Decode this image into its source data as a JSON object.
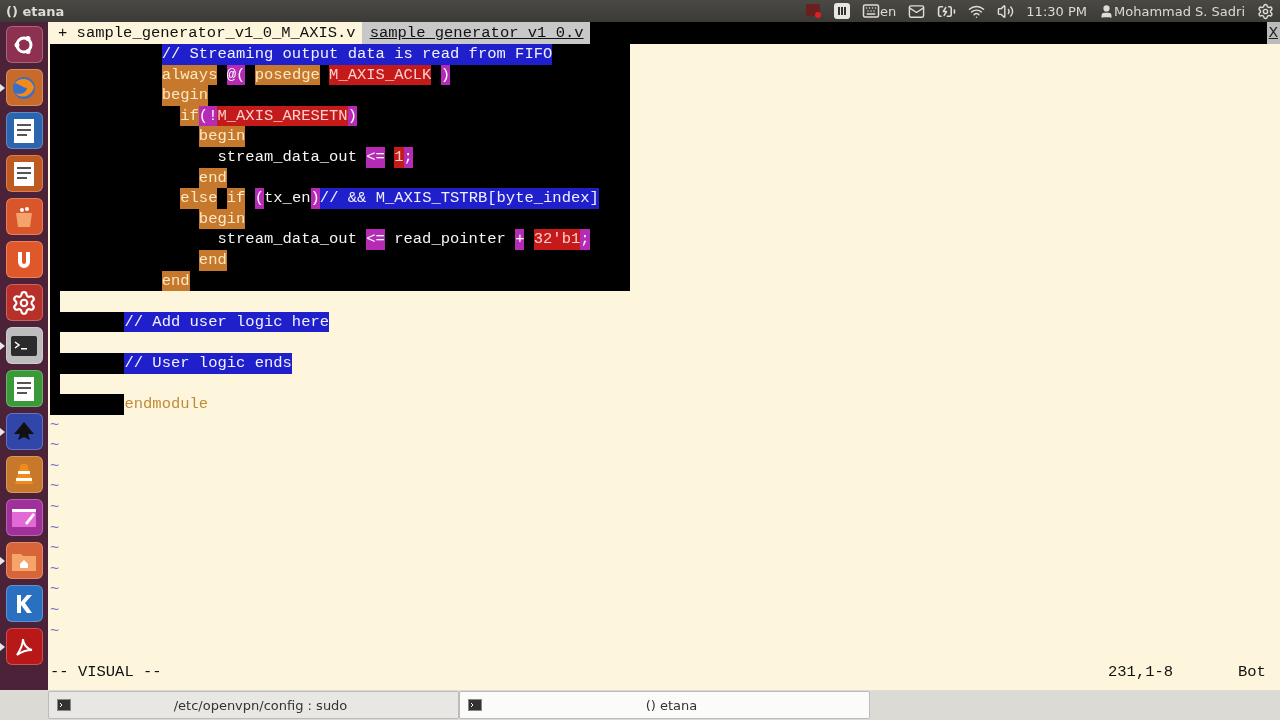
{
  "top_panel": {
    "title": "() etana",
    "keyboard_layout": "en",
    "clock": "11:30 PM",
    "user": "Mohammad S. Sadri"
  },
  "launcher": [
    {
      "kind": "ubuntu",
      "running": false
    },
    {
      "kind": "firefox",
      "running": true
    },
    {
      "kind": "writer",
      "running": false
    },
    {
      "kind": "impress",
      "running": false
    },
    {
      "kind": "software",
      "running": false
    },
    {
      "kind": "ubuntuone",
      "running": false
    },
    {
      "kind": "settings",
      "running": false
    },
    {
      "kind": "terminal",
      "running": true
    },
    {
      "kind": "calc",
      "running": false
    },
    {
      "kind": "inkscape",
      "running": true
    },
    {
      "kind": "vlc",
      "running": false
    },
    {
      "kind": "video",
      "running": false
    },
    {
      "kind": "files",
      "running": true
    },
    {
      "kind": "kde",
      "running": false
    },
    {
      "kind": "acrobat",
      "running": true
    }
  ],
  "editor": {
    "tabs": [
      {
        "label": "+ sample_generator_v1_0_M_AXIS.v",
        "selected": true
      },
      {
        "label": "sample_generator_v1_0.v",
        "selected": false
      }
    ],
    "close_label": "X",
    "lines": [
      {
        "kind": "block",
        "segments": [
          {
            "kind": "comment",
            "text": "            // Streaming output data is read from FIFO"
          }
        ]
      },
      {
        "kind": "block",
        "segments": [
          {
            "kind": "keyword",
            "text": "            always "
          },
          {
            "kind": "operator",
            "text": "@( "
          },
          {
            "kind": "keyword",
            "text": "posedge "
          },
          {
            "kind": "constant",
            "text": "M_AXIS_ACLK "
          },
          {
            "kind": "operator",
            "text": ")"
          }
        ]
      },
      {
        "kind": "block",
        "segments": [
          {
            "kind": "keyword",
            "text": "            begin"
          }
        ]
      },
      {
        "kind": "block",
        "segments": [
          {
            "kind": "keyword",
            "text": "              if"
          },
          {
            "kind": "operator",
            "text": "(!"
          },
          {
            "kind": "constant",
            "text": "M_AXIS_ARESETN"
          },
          {
            "kind": "operator",
            "text": ")"
          }
        ]
      },
      {
        "kind": "block",
        "segments": [
          {
            "kind": "keyword",
            "text": "                begin"
          }
        ]
      },
      {
        "kind": "block",
        "segments": [
          {
            "kind": "text",
            "text": "                  stream_data_out "
          },
          {
            "kind": "operator",
            "text": "<= "
          },
          {
            "kind": "constant",
            "text": "1"
          },
          {
            "kind": "operator",
            "text": ";"
          }
        ]
      },
      {
        "kind": "block",
        "segments": [
          {
            "kind": "keyword",
            "text": "                end"
          }
        ]
      },
      {
        "kind": "block",
        "segments": [
          {
            "kind": "keyword",
            "text": "              else "
          },
          {
            "kind": "keyword",
            "text": "if "
          },
          {
            "kind": "operator",
            "text": "("
          },
          {
            "kind": "text",
            "text": "tx_en"
          },
          {
            "kind": "operator",
            "text": ")"
          },
          {
            "kind": "comment",
            "text": "// && M_AXIS_TSTRB[byte_index]"
          }
        ]
      },
      {
        "kind": "block",
        "segments": [
          {
            "kind": "keyword",
            "text": "                begin"
          }
        ]
      },
      {
        "kind": "block",
        "segments": [
          {
            "kind": "text",
            "text": "                  stream_data_out "
          },
          {
            "kind": "operator",
            "text": "<= "
          },
          {
            "kind": "text",
            "text": "read_pointer "
          },
          {
            "kind": "operator",
            "text": "+ "
          },
          {
            "kind": "constant",
            "text": "32'b1"
          },
          {
            "kind": "operator",
            "text": ";"
          }
        ]
      },
      {
        "kind": "block",
        "segments": [
          {
            "kind": "keyword",
            "text": "                end"
          }
        ]
      },
      {
        "kind": "block",
        "segments": [
          {
            "kind": "keyword",
            "text": "            end"
          }
        ]
      },
      {
        "kind": "inline"
      },
      {
        "kind": "inline",
        "segments": [
          {
            "kind": "comment",
            "text": "        // Add user logic here"
          }
        ]
      },
      {
        "kind": "inline"
      },
      {
        "kind": "inline",
        "segments": [
          {
            "kind": "comment",
            "text": "        // User logic ends"
          }
        ]
      },
      {
        "kind": "inline"
      },
      {
        "kind": "inline",
        "segments": [
          {
            "kind": "plain_keyword",
            "text": "        endmodule"
          }
        ]
      }
    ],
    "tildes": [
      "~",
      "~",
      "~",
      "~",
      "~",
      "~",
      "~",
      "~",
      "~",
      "~",
      "~"
    ],
    "status": {
      "mode": "-- VISUAL --",
      "position": "231,1-8",
      "scroll": "Bot"
    }
  },
  "taskbar": [
    {
      "label": "/etc/openvpn/config : sudo",
      "selected": false
    },
    {
      "label": "() etana",
      "selected": true
    }
  ]
}
